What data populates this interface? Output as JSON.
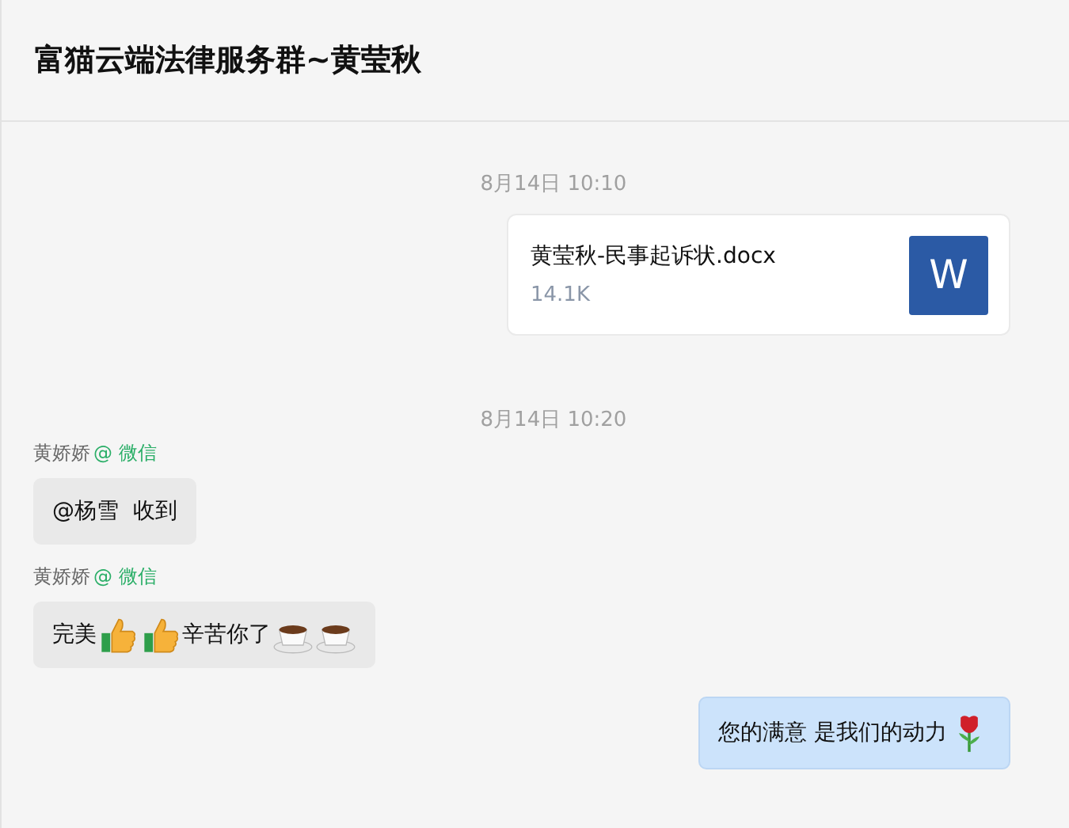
{
  "header": {
    "title": "富猫云端法律服务群~黄莹秋"
  },
  "messages": [
    {
      "kind": "time",
      "text": "8月14日 10:10"
    },
    {
      "kind": "file",
      "outgoing": true,
      "file_name": "黄莹秋-民事起诉状.docx",
      "size": "14.1K",
      "type_label": "W"
    },
    {
      "kind": "time",
      "text": "8月14日 10:20"
    },
    {
      "kind": "text",
      "outgoing": false,
      "sender": "黄娇娇",
      "source": "@ 微信",
      "parts": [
        {
          "kind": "text",
          "text": "@杨雪  收到"
        }
      ]
    },
    {
      "kind": "text",
      "outgoing": false,
      "sender": "黄娇娇",
      "source": "@ 微信",
      "parts": [
        {
          "kind": "text",
          "text": "完美"
        },
        {
          "kind": "thumbs-up"
        },
        {
          "kind": "thumbs-up"
        },
        {
          "kind": "text",
          "text": "辛苦你了"
        },
        {
          "kind": "coffee"
        },
        {
          "kind": "coffee"
        }
      ]
    },
    {
      "kind": "text",
      "outgoing": true,
      "parts": [
        {
          "kind": "text",
          "text": "您的满意 是我们的动力"
        },
        {
          "kind": "rose"
        }
      ]
    }
  ]
}
